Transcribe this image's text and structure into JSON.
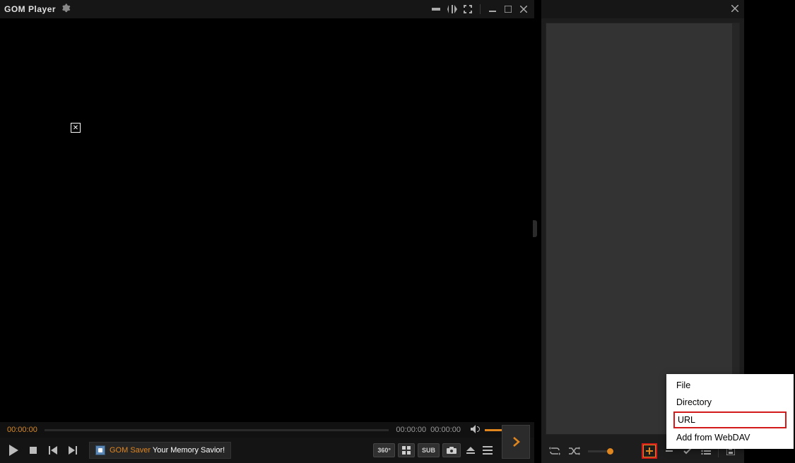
{
  "app": {
    "brandBold": "GOM",
    "brandLight": " Player"
  },
  "seek": {
    "left": "00:00:00",
    "right": "00:00:00",
    "total": "00:00:00"
  },
  "promo": {
    "accent": "GOM Saver",
    "rest": " Your Memory Savior!"
  },
  "pills": {
    "deg": "360°",
    "sub": "SUB"
  },
  "popup": {
    "file": "File",
    "directory": "Directory",
    "url": "URL",
    "webdav": "Add from WebDAV"
  }
}
